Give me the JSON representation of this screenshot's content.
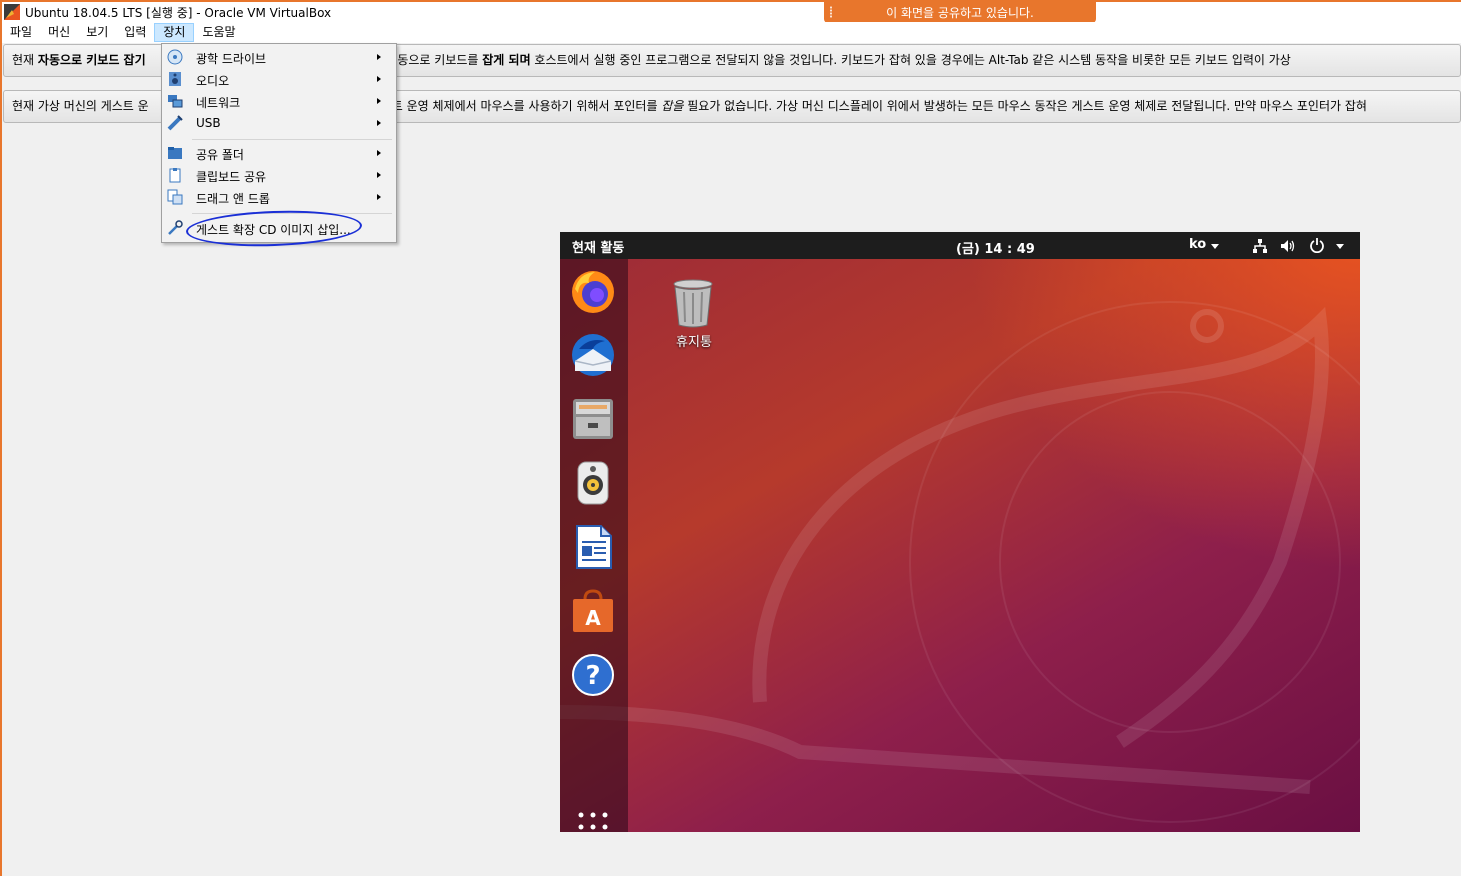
{
  "window": {
    "title": "Ubuntu 18.04.5 LTS [실행 중] - Oracle VM VirtualBox"
  },
  "share_notice": "이 화면을 공유하고 있습니다.",
  "menubar": [
    {
      "label": "파일"
    },
    {
      "label": "머신"
    },
    {
      "label": "보기"
    },
    {
      "label": "입력"
    },
    {
      "label": "장치"
    },
    {
      "label": "도움말"
    }
  ],
  "notices": {
    "keyboard": {
      "pre": "현재 ",
      "bold1": "자동으로 키보드 잡기",
      "mid": "화되어 있을 때 자동으로 키보드를 ",
      "bold2": "잡게 되며",
      "post": " 호스트에서 실행 중인 프로그램으로 전달되지 않을 것입니다. 키보드가 잡혀 있을 경우에는 Alt-Tab 같은 시스템 동작을 비롯한 모든 키보드 입력이 가상"
    },
    "mouse": {
      "pre": "현재 가상 머신의 게스트 운",
      "mid": "스트 운영 체제에서 마우스를 사용하기 위해서 포인터를 ",
      "italic": "잡을",
      "post": " 필요가 없습니다. 가상 머신 디스플레이 위에서 발생하는 모든 마우스 동작은 게스트 운영 체제로 전달됩니다. 만약 마우스 포인터가 잡혀"
    }
  },
  "devices_menu": [
    {
      "label": "광학 드라이브",
      "icon": "optical-drive-icon",
      "submenu": true
    },
    {
      "label": "오디오",
      "icon": "audio-icon",
      "submenu": true
    },
    {
      "label": "네트워크",
      "icon": "network-icon",
      "submenu": true
    },
    {
      "label": "USB",
      "icon": "usb-icon",
      "submenu": true
    },
    {
      "label": "공유 폴더",
      "icon": "shared-folder-icon",
      "submenu": true
    },
    {
      "label": "클립보드 공유",
      "icon": "clipboard-icon",
      "submenu": true
    },
    {
      "label": "드래그 앤 드롭",
      "icon": "drag-drop-icon",
      "submenu": true
    },
    {
      "label": "게스트 확장 CD 이미지 삽입...",
      "icon": "guest-additions-icon",
      "submenu": false
    }
  ],
  "guest": {
    "activities": "현재 활동",
    "clock": "(금) 14 : 49",
    "lang": "ko",
    "trash_label": "휴지통",
    "dock": [
      "firefox-icon",
      "thunderbird-icon",
      "files-icon",
      "rhythmbox-icon",
      "libreoffice-writer-icon",
      "software-center-icon",
      "help-icon"
    ],
    "colors": {
      "accent": "#e95420",
      "aubergine": "#77216f"
    }
  }
}
